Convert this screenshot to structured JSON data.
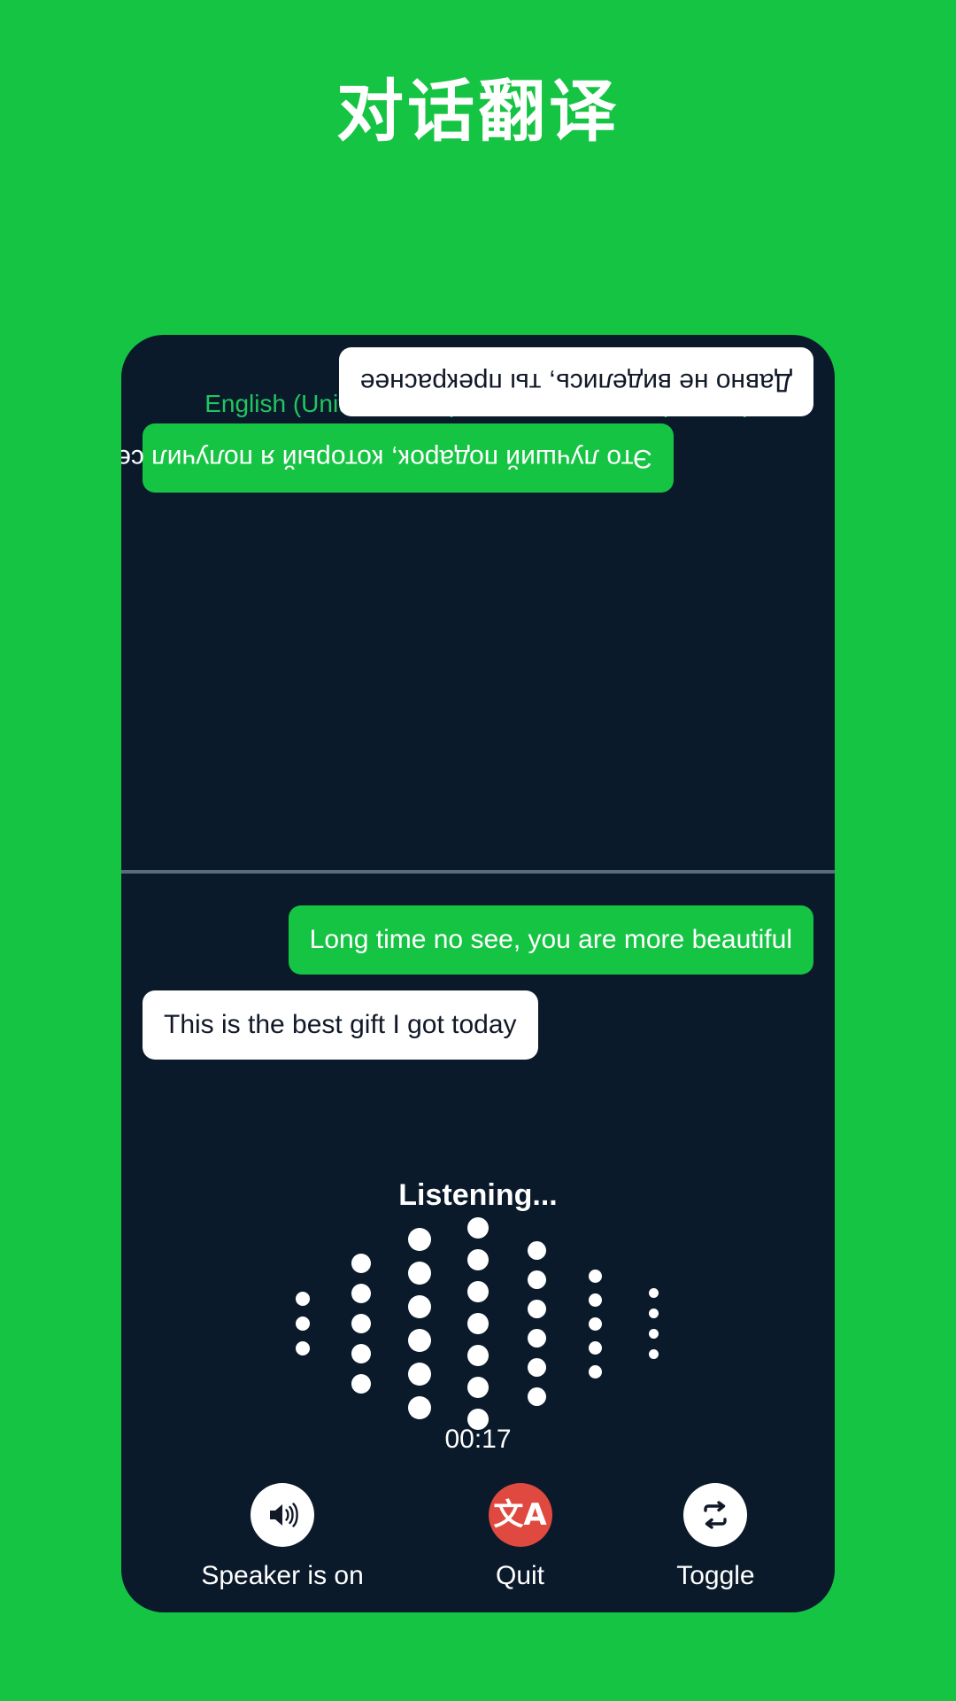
{
  "page": {
    "title": "对话翻译",
    "background_color": "#16c444"
  },
  "card": {
    "background_color": "#0a1a2b",
    "accent_green": "#16c444",
    "language_text_color": "#22c55e"
  },
  "language_bar": {
    "source_language": "English (United States)",
    "swap_icon": "swap-horizontal-icon",
    "target_language": "Russian (Russia)"
  },
  "conversation": {
    "translated_panel": {
      "orientation": "rotated-180",
      "messages": [
        {
          "text": "Это лучший подарок, который я получил сегодня",
          "style": "green",
          "align": "left"
        },
        {
          "text": "Давно не виделись, ты прекраснее",
          "style": "white",
          "align": "right"
        }
      ]
    },
    "source_panel": {
      "orientation": "normal",
      "messages": [
        {
          "text": "Long time no see, you are more beautiful",
          "style": "green",
          "align": "right"
        },
        {
          "text": "This is the best gift I got today",
          "style": "white",
          "align": "left"
        }
      ]
    }
  },
  "status": {
    "listening_label": "Listening...",
    "timer": "00:17"
  },
  "waveform": {
    "columns": [
      {
        "dots": 3,
        "size": 16
      },
      {
        "dots": 5,
        "size": 22
      },
      {
        "dots": 6,
        "size": 26
      },
      {
        "dots": 7,
        "size": 24
      },
      {
        "dots": 6,
        "size": 21
      },
      {
        "dots": 5,
        "size": 15
      },
      {
        "dots": 4,
        "size": 11
      }
    ],
    "dot_color": "#ffffff"
  },
  "controls": [
    {
      "label": "Speaker is on",
      "icon": "speaker-on-icon",
      "circle_style": "light",
      "circle_color": "#ffffff"
    },
    {
      "label": "Quit",
      "icon": "translate-icon",
      "circle_style": "red",
      "circle_color": "#e0493f",
      "glyph": "文A"
    },
    {
      "label": "Toggle",
      "icon": "repeat-swap-icon",
      "circle_style": "light",
      "circle_color": "#ffffff"
    }
  ]
}
